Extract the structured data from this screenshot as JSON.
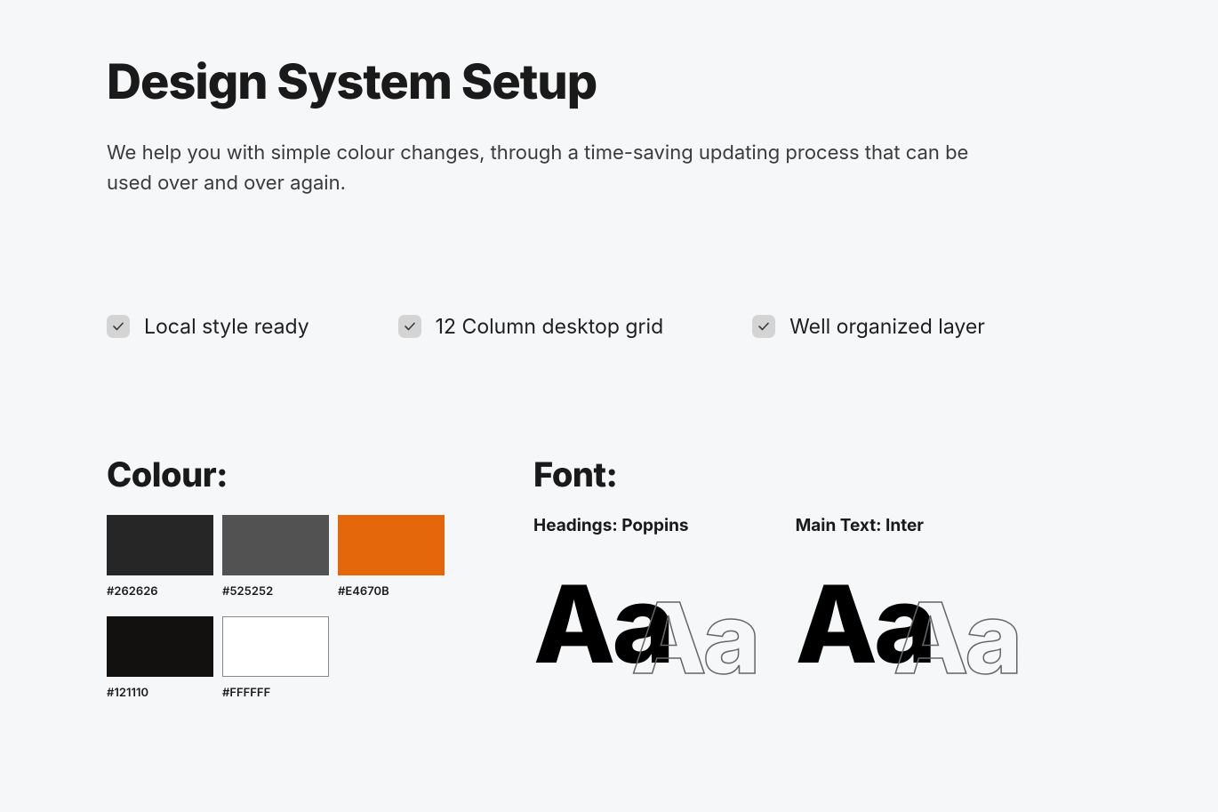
{
  "title": "Design System Setup",
  "description": "We help you with simple colour changes, through a time-saving updating process that can be used over and over again.",
  "features": [
    {
      "label": "Local style ready"
    },
    {
      "label": "12 Column desktop grid"
    },
    {
      "label": "Well organized layer"
    }
  ],
  "colour": {
    "heading": "Colour:",
    "swatches": [
      {
        "hex": "#262626"
      },
      {
        "hex": "#525252"
      },
      {
        "hex": "#E4670B"
      },
      {
        "hex": "#121110"
      },
      {
        "hex": "#FFFFFF"
      }
    ]
  },
  "font": {
    "heading": "Font:",
    "headings_label": "Headings:",
    "headings_name": "Poppins",
    "main_label": "Main Text:",
    "main_name": "Inter",
    "sample_solid": "Aa",
    "sample_outline": "Aa"
  }
}
